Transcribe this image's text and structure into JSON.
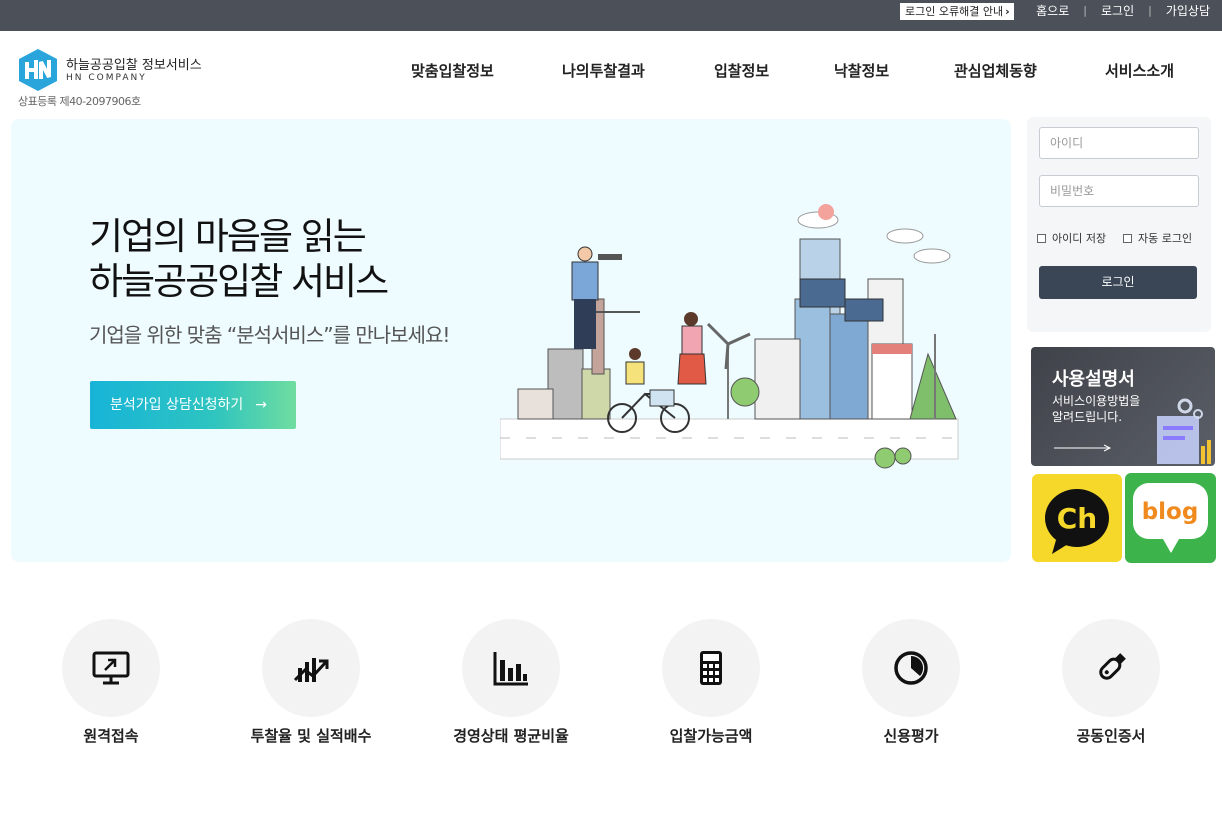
{
  "topbar": {
    "error_guide": "로그인 오류해결 안내",
    "links": [
      "홈으로",
      "로그인",
      "가입상담"
    ]
  },
  "header": {
    "brand_name": "하늘공공입찰 정보서비스",
    "brand_sub": "HN COMPANY",
    "trademark": "상표등록 제40-2097906호",
    "nav": [
      "맞춤입찰정보",
      "나의투찰결과",
      "입찰정보",
      "낙찰정보",
      "관심업체동향",
      "서비스소개"
    ]
  },
  "hero": {
    "title_line1": "기업의 마음을 읽는",
    "title_line2": "하늘공공입찰 서비스",
    "subtitle": "기업을 위한 맞춤 “분석서비스”를 만나보세요!",
    "cta_label": "분석가입 상담신청하기",
    "cta_arrow": "→"
  },
  "login": {
    "id_placeholder": "아이디",
    "pw_placeholder": "비밀번호",
    "save_id": "아이디 저장",
    "auto_login": "자동 로그인",
    "button": "로그인"
  },
  "manual": {
    "title": "사용설명서",
    "desc": "서비스이용방법을\n알려드립니다."
  },
  "kakao": {
    "label": "Ch"
  },
  "blog": {
    "label": "blog"
  },
  "services": [
    {
      "label": "원격접속",
      "icon": "remote-monitor-icon"
    },
    {
      "label": "투찰율 및 실적배수",
      "icon": "trend-chart-icon"
    },
    {
      "label": "경영상태 평균비율",
      "icon": "bar-chart-icon"
    },
    {
      "label": "입찰가능금액",
      "icon": "calculator-icon"
    },
    {
      "label": "신용평가",
      "icon": "pie-clock-icon"
    },
    {
      "label": "공동인증서",
      "icon": "usb-key-icon"
    }
  ],
  "colors": {
    "topbar": "#4b5059",
    "hero_bg": "#eefbff",
    "login_button": "#3a4656",
    "cta_start": "#17b4d8",
    "cta_end": "#6fdda0",
    "kakao": "#f6d82a",
    "blog": "#3cb44b"
  }
}
